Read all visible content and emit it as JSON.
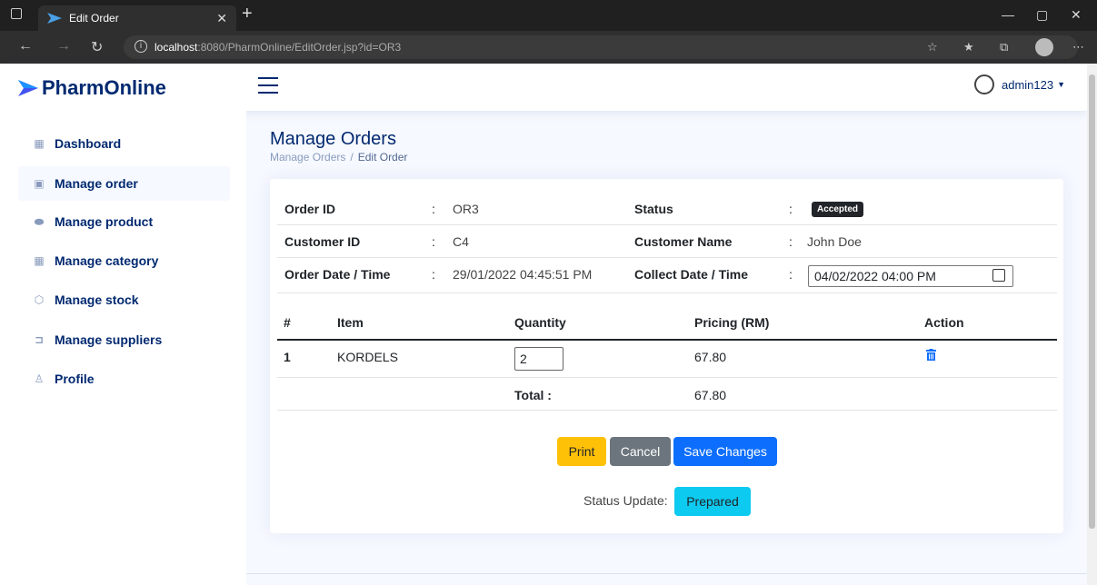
{
  "browser": {
    "tab_title": "Edit Order",
    "url_host": "localhost",
    "url_rest": ":8080/PharmOnline/EditOrder.jsp?id=OR3"
  },
  "header": {
    "brand": "PharmOnline",
    "username": "admin123"
  },
  "sidebar": {
    "items": [
      {
        "label": "Dashboard",
        "icon": "grid-icon"
      },
      {
        "label": "Manage order",
        "icon": "clipboard-icon"
      },
      {
        "label": "Manage product",
        "icon": "capsule-icon"
      },
      {
        "label": "Manage category",
        "icon": "grid-icon"
      },
      {
        "label": "Manage stock",
        "icon": "box-icon"
      },
      {
        "label": "Manage suppliers",
        "icon": "truck-icon"
      },
      {
        "label": "Profile",
        "icon": "person-icon"
      }
    ]
  },
  "page": {
    "title": "Manage Orders",
    "breadcrumb": [
      "Manage Orders",
      "/",
      "Edit Order"
    ]
  },
  "order": {
    "order_id_label": "Order ID",
    "order_id": "OR3",
    "status_label": "Status",
    "status": "Accepted",
    "customer_id_label": "Customer ID",
    "customer_id": "C4",
    "customer_name_label": "Customer Name",
    "customer_name": "John Doe",
    "order_date_label": "Order Date / Time",
    "order_date": "29/01/2022 04:45:51 PM",
    "collect_date_label": "Collect Date / Time",
    "collect_date": "04/02/2022 04:00 PM",
    "colon": ":"
  },
  "items_table": {
    "headers": [
      "#",
      "Item",
      "Quantity",
      "Pricing (RM)",
      "Action"
    ],
    "rows": [
      {
        "no": "1",
        "item": "KORDELS",
        "quantity": "2",
        "pricing": "67.80"
      }
    ],
    "total_label": "Total :",
    "total": "67.80"
  },
  "actions": {
    "print": "Print",
    "cancel": "Cancel",
    "save": "Save Changes",
    "status_update_label": "Status Update:",
    "status_update_button": "Prepared"
  },
  "colors": {
    "brand": "#012970",
    "primary": "#0d6efd",
    "warning": "#ffc107",
    "secondary": "#6c757d",
    "info": "#0dcaf0"
  }
}
